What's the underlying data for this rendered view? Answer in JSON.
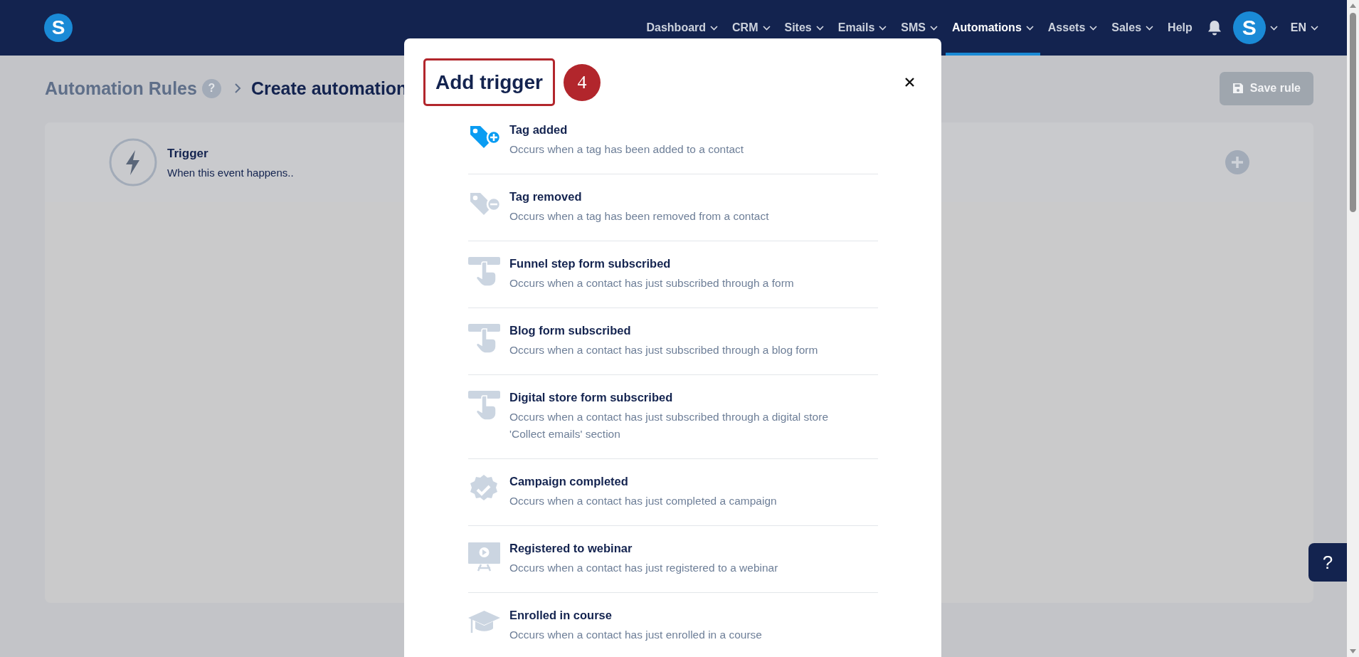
{
  "logo": {
    "letter": "S"
  },
  "nav": {
    "items": [
      {
        "label": "Dashboard",
        "selected": false,
        "has_menu": true
      },
      {
        "label": "CRM",
        "selected": false,
        "has_menu": true
      },
      {
        "label": "Sites",
        "selected": false,
        "has_menu": true
      },
      {
        "label": "Emails",
        "selected": false,
        "has_menu": true
      },
      {
        "label": "SMS",
        "selected": false,
        "has_menu": true
      },
      {
        "label": "Automations",
        "selected": true,
        "has_menu": true
      },
      {
        "label": "Assets",
        "selected": false,
        "has_menu": true
      },
      {
        "label": "Sales",
        "selected": false,
        "has_menu": true
      },
      {
        "label": "Help",
        "selected": false,
        "has_menu": false
      }
    ],
    "avatar": {
      "letter": "S"
    },
    "language": "EN"
  },
  "breadcrumb": {
    "parent": "Automation Rules",
    "help": "?",
    "current": "Create automation"
  },
  "save_button": {
    "label": "Save rule",
    "disabled": true
  },
  "trigger_card": {
    "title": "Trigger",
    "subtitle": "When this event happens.."
  },
  "modal": {
    "title": "Add trigger",
    "step_badge": "4",
    "items": [
      {
        "kind": "tag-add",
        "title": "Tag added",
        "description": "Occurs when a tag has been added to a contact",
        "highlighted": true
      },
      {
        "kind": "tag-remove",
        "title": "Tag removed",
        "description": "Occurs when a tag has been removed from a contact",
        "highlighted": false
      },
      {
        "kind": "form",
        "title": "Funnel step form subscribed",
        "description": "Occurs when a contact has just subscribed through a form",
        "highlighted": false
      },
      {
        "kind": "form",
        "title": "Blog form subscribed",
        "description": "Occurs when a contact has just subscribed through a blog form",
        "highlighted": false
      },
      {
        "kind": "form",
        "title": "Digital store form subscribed",
        "description": "Occurs when a contact has just subscribed through a digital store 'Collect emails' section",
        "highlighted": false
      },
      {
        "kind": "badge",
        "title": "Campaign completed",
        "description": "Occurs when a contact has just completed a campaign",
        "highlighted": false
      },
      {
        "kind": "webinar",
        "title": "Registered to webinar",
        "description": "Occurs when a contact has just registered to a webinar",
        "highlighted": false
      },
      {
        "kind": "course",
        "title": "Enrolled in course",
        "description": "Occurs when a contact has just enrolled in a course",
        "highlighted": false
      }
    ]
  },
  "help_button": {
    "label": "?"
  }
}
